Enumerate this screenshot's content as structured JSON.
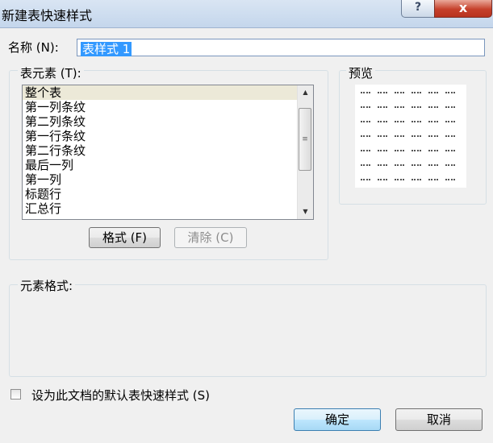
{
  "window": {
    "title": "新建表快速样式",
    "help_label": "?",
    "close_label": "x"
  },
  "name": {
    "label": "名称 (N):",
    "value": "表样式 1"
  },
  "table_elements": {
    "label": "表元素 (T):",
    "items": [
      {
        "label": "整个表",
        "selected": true
      },
      {
        "label": "第一列条纹"
      },
      {
        "label": "第二列条纹"
      },
      {
        "label": "第一行条纹"
      },
      {
        "label": "第二行条纹"
      },
      {
        "label": "最后一列"
      },
      {
        "label": "第一列"
      },
      {
        "label": "标题行"
      },
      {
        "label": "汇总行"
      }
    ],
    "format_button": "格式 (F)",
    "clear_button": "清除 (C)"
  },
  "preview": {
    "label": "预览"
  },
  "element_format": {
    "label": "元素格式:"
  },
  "default_checkbox": {
    "label": "设为此文档的默认表快速样式 (S)",
    "checked": false
  },
  "buttons": {
    "ok": "确定",
    "cancel": "取消"
  }
}
